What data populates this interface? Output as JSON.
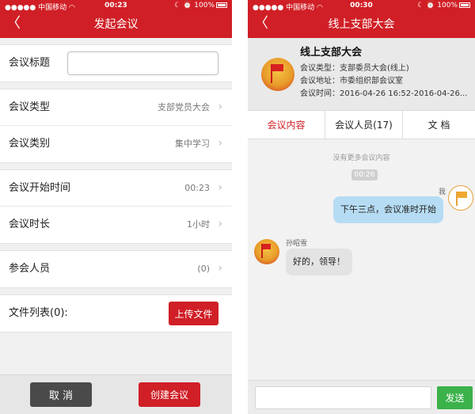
{
  "left": {
    "status": {
      "carrier": "中国移动",
      "time": "00:23",
      "battery": "100%"
    },
    "nav": {
      "back": "〈",
      "title": "发起会议"
    },
    "form": {
      "title_label": "会议标题",
      "title_value": "",
      "type_label": "会议类型",
      "type_value": "支部党员大会",
      "category_label": "会议类别",
      "category_value": "集中学习",
      "start_label": "会议开始时间",
      "start_value": "00:23",
      "duration_label": "会议时长",
      "duration_value": "1小时",
      "attendees_label": "参会人员",
      "attendees_value": "(0)",
      "files_label": "文件列表(0):",
      "upload_label": "上传文件",
      "chevron": "›"
    },
    "footer": {
      "cancel_label": "取 消",
      "create_label": "创建会议"
    }
  },
  "right": {
    "status": {
      "carrier": "中国移动",
      "time": "00:30",
      "battery": "100%"
    },
    "nav": {
      "back": "〈",
      "title": "线上支部大会"
    },
    "info": {
      "title": "线上支部大会",
      "type": "会议类型：支部委员大会(线上)",
      "address": "会议地址：市委组织部会议室",
      "time": "会议时间：2016-04-26 16:52-2016-04-26..."
    },
    "tabs": [
      {
        "label": "会议内容",
        "active": true
      },
      {
        "label": "会议人员(17)",
        "active": false
      },
      {
        "label": "文 档",
        "active": false
      }
    ],
    "chat": {
      "no_more": "没有更多会议内容",
      "time_chip": "00:26",
      "me_name": "我",
      "me_message": "下午三点，会议准时开始",
      "other_name": "孙昭雪",
      "other_message": "好的，领导！"
    },
    "footer": {
      "input_placeholder": "",
      "send_label": "发送"
    }
  },
  "colors": {
    "brand_red": "#d01f26",
    "send_green": "#3bb24a",
    "bubble_me": "#b6dcf3",
    "bubble_other": "#e3e3e3"
  },
  "icons": [
    "back-chevron-icon",
    "wifi-icon",
    "battery-icon",
    "alarm-icon",
    "moon-icon",
    "chevron-right-icon",
    "party-emblem-icon",
    "flag-icon"
  ]
}
